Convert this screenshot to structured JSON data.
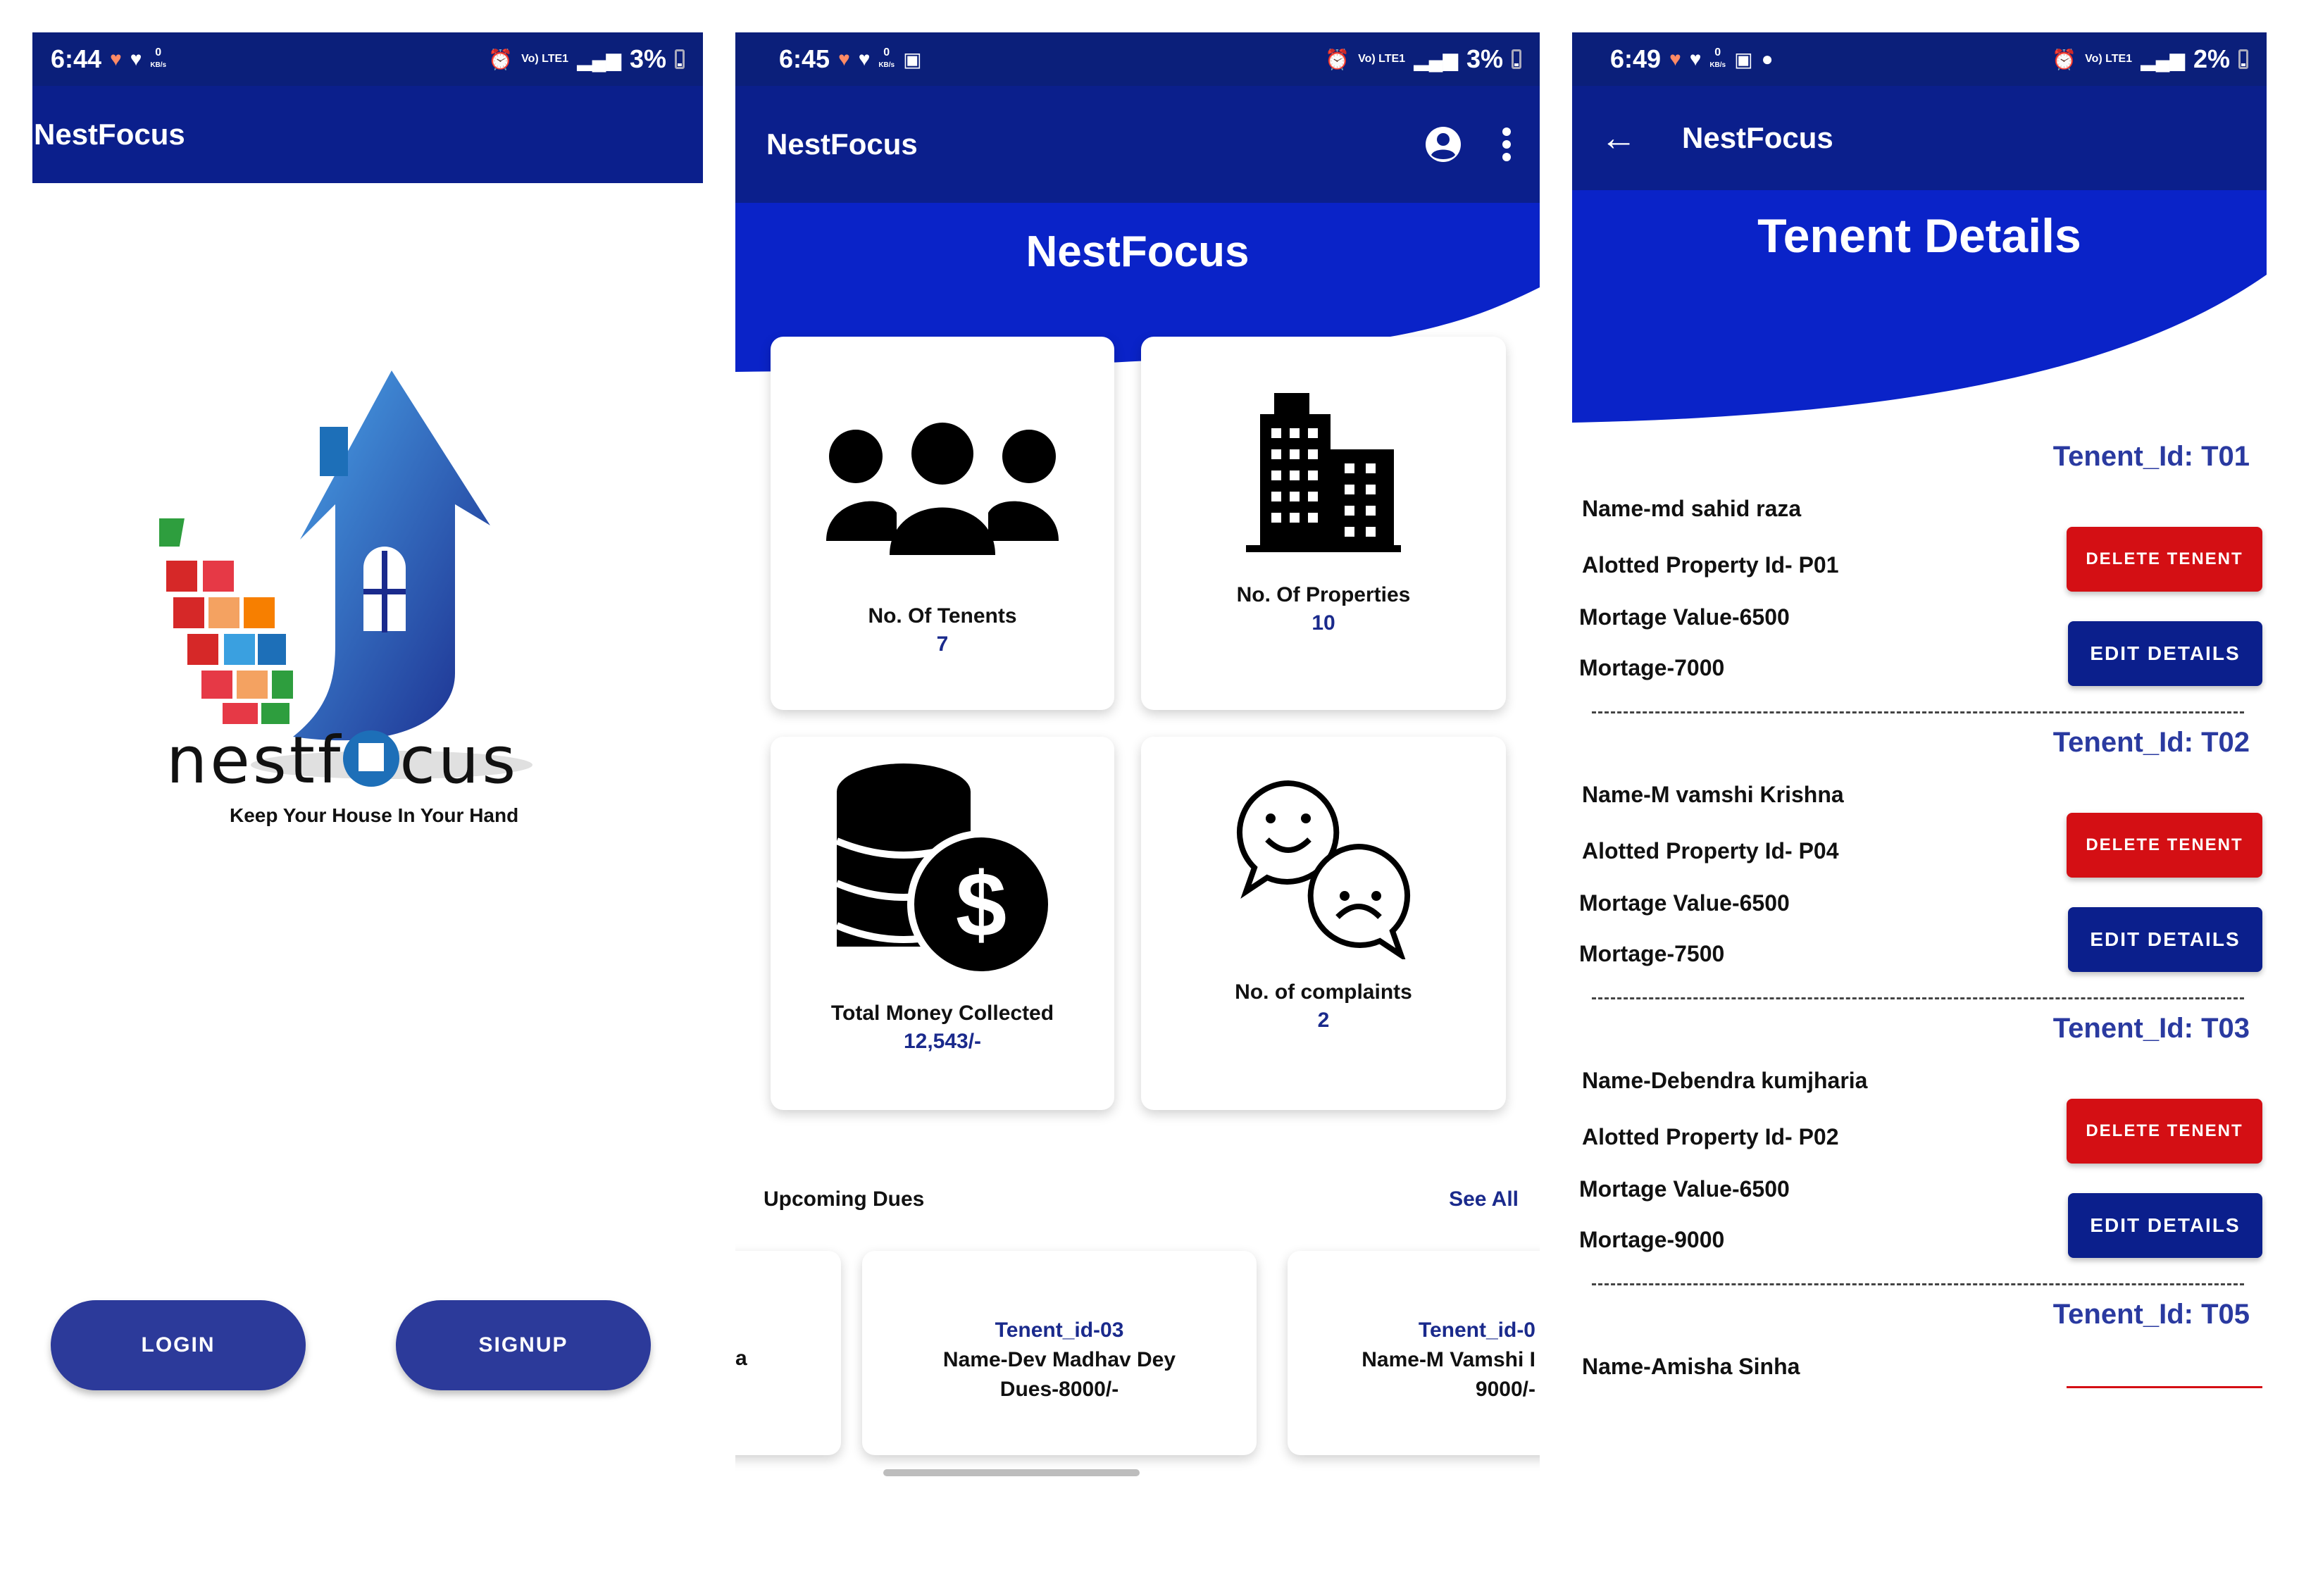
{
  "colors": {
    "primary": "#0b1f8c",
    "status": "#0b1f7a",
    "hero": "#0a23c8",
    "button": "#2c3a9a",
    "danger": "#d40f14",
    "accent_text": "#2a3aa0"
  },
  "panel1": {
    "status": {
      "time": "6:44",
      "kbs": "0",
      "kbs_unit": "KB/s",
      "lte": "Vo) LTE1",
      "battery": "3%"
    },
    "appbar_title": "NestFocus",
    "brand_left": "nestf",
    "brand_right": "cus",
    "tagline": "Keep Your House In Your Hand",
    "login_label": "LOGIN",
    "signup_label": "SIGNUP"
  },
  "panel2": {
    "status": {
      "time": "6:45",
      "kbs": "0",
      "kbs_unit": "KB/s",
      "lte": "Vo) LTE1",
      "battery": "3%"
    },
    "appbar_title": "NestFocus",
    "hero_title": "NestFocus",
    "cards": [
      {
        "label": "No. Of Tenents",
        "value": "7",
        "icon": "people-icon"
      },
      {
        "label": "No. Of Properties",
        "value": "10",
        "icon": "buildings-icon"
      },
      {
        "label": "Total Money Collected",
        "value": "12,543/-",
        "icon": "money-icon"
      },
      {
        "label": "No. of complaints",
        "value": "2",
        "icon": "complaints-icon"
      }
    ],
    "upcoming_title": "Upcoming Dues",
    "see_all": "See All",
    "dues": [
      {
        "id": "Tenent_id-03",
        "name": "Name-Dev Madhav Dey",
        "dues": "Dues-8000/-"
      },
      {
        "id": "Tenent_id-0",
        "name": "Name-M Vamshi I",
        "dues": "9000/-"
      }
    ],
    "partial_left_char": "a"
  },
  "panel3": {
    "status": {
      "time": "6:49",
      "kbs": "0",
      "kbs_unit": "KB/s",
      "lte": "Vo) LTE1",
      "battery": "2%"
    },
    "appbar_title": "NestFocus",
    "hero_title": "Tenent Details",
    "delete_label": "DELETE TENENT",
    "edit_label": "EDIT DETAILS",
    "tenants": [
      {
        "id": "Tenent_Id: T01",
        "name": "Name-md sahid raza",
        "property": "Alotted Property Id- P01",
        "mortgage_value": "Mortage Value-6500",
        "mortgage": "Mortage-7000"
      },
      {
        "id": "Tenent_Id: T02",
        "name": "Name-M vamshi Krishna",
        "property": "Alotted Property Id- P04",
        "mortgage_value": "Mortage Value-6500",
        "mortgage": "Mortage-7500"
      },
      {
        "id": "Tenent_Id: T03",
        "name": "Name-Debendra kumjharia",
        "property": "Alotted Property Id- P02",
        "mortgage_value": "Mortage Value-6500",
        "mortgage": "Mortage-9000"
      },
      {
        "id": "Tenent_Id: T05",
        "name": "Name-Amisha Sinha"
      }
    ]
  }
}
